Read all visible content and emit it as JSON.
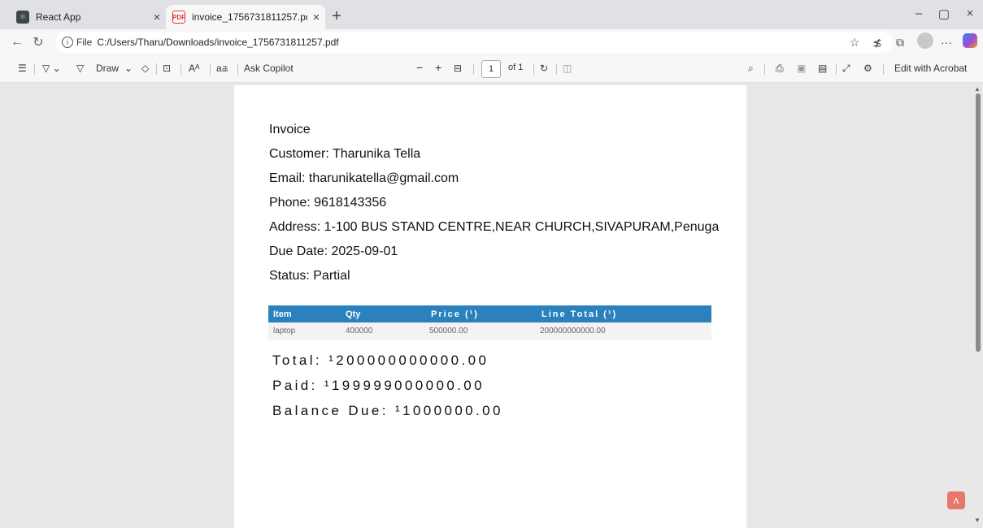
{
  "tabs": [
    {
      "title": "React App",
      "icon": "react-icon"
    },
    {
      "title": "invoice_1756731811257.pdf",
      "icon": "pdf-icon"
    }
  ],
  "window_controls": {
    "minimize": "–",
    "maximize": "▢",
    "close": "×"
  },
  "address": {
    "file_label": "File",
    "url": "C:/Users/Tharu/Downloads/invoice_1756731811257.pdf"
  },
  "pdf_toolbar": {
    "draw_label": "Draw",
    "ask_copilot": "Ask Copilot",
    "read_aloud": "a𝕒",
    "zoom_out": "−",
    "zoom_in": "+",
    "page_current": "1",
    "page_total": "of 1",
    "edit_acrobat": "Edit with Acrobat"
  },
  "invoice": {
    "heading": "Invoice",
    "customer": "Customer: Tharunika Tella",
    "email": "Email: tharunikatella@gmail.com",
    "phone": "Phone: 9618143356",
    "address": "Address: 1-100 BUS STAND CENTRE,NEAR CHURCH,SIVAPURAM,Penuga",
    "due_date": "Due Date: 2025-09-01",
    "status": "Status: Partial",
    "table": {
      "headers": [
        "Item",
        "Qty",
        "Price (¹)",
        "Line Total (¹)"
      ],
      "rows": [
        [
          "laptop",
          "400000",
          "500000.00",
          "200000000000.00"
        ]
      ]
    },
    "total": "Total: ¹200000000000.00",
    "paid": "Paid: ¹199999000000.00",
    "balance": "Balance Due: ¹1000000.00"
  }
}
